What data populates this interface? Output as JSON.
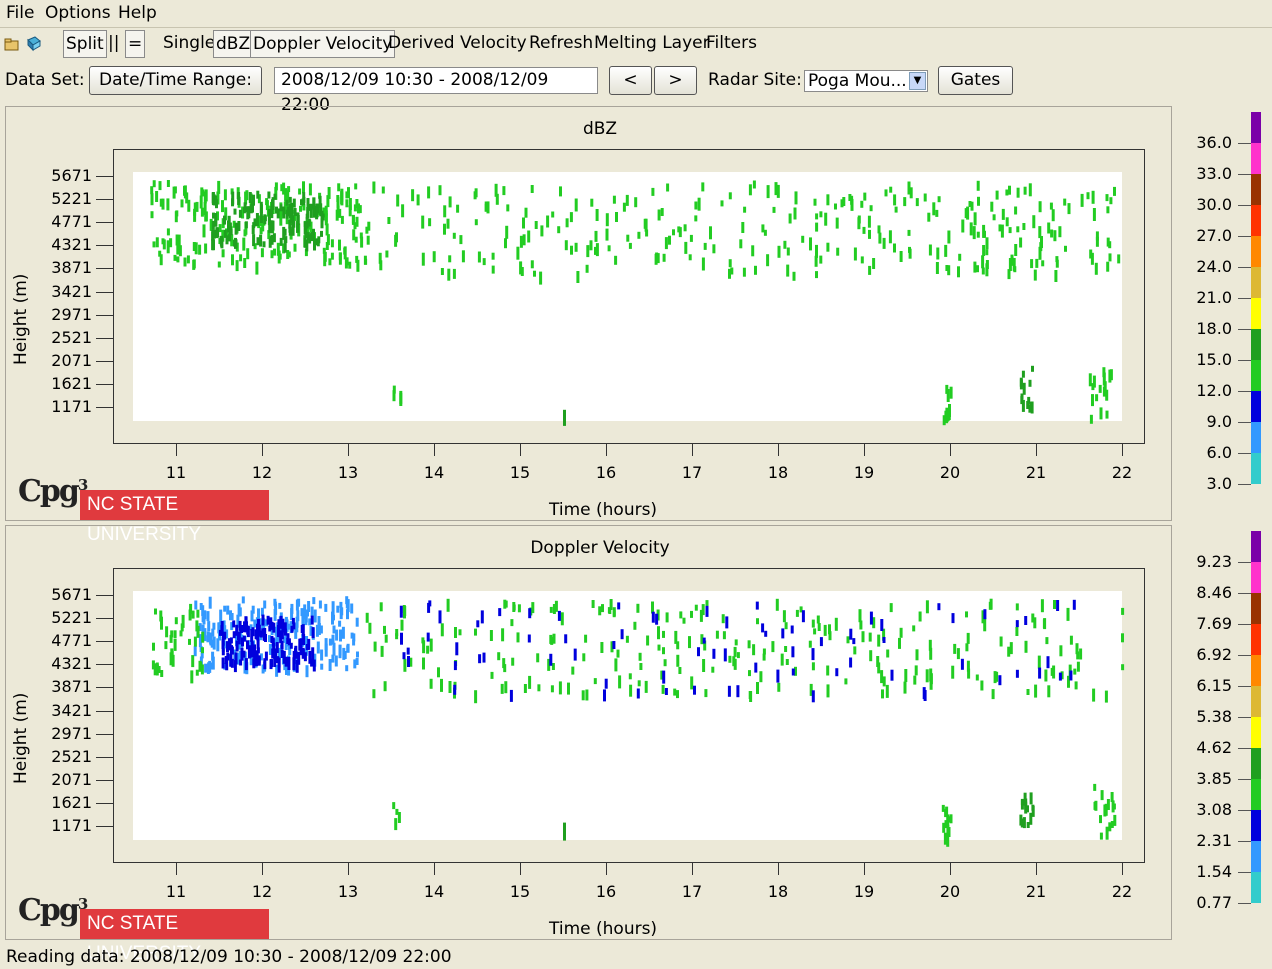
{
  "menu": [
    "File",
    "Options",
    "Help"
  ],
  "toolbar": {
    "split": "Split",
    "pipes": "||",
    "equals": "=",
    "single": "Single",
    "dbz": "dBZ",
    "doppler": "Doppler Velocity",
    "derived": "Derived Velocity",
    "refresh": "Refresh",
    "melting": "Melting Layer",
    "filters": "Filters"
  },
  "dataset": {
    "label": "Data Set:",
    "range_button": "Date/Time Range:",
    "range_value": "2008/12/09 10:30 - 2008/12/09 22:00",
    "prev": "<",
    "next": ">",
    "radar_label": "Radar Site:",
    "radar_value": "Poga Mou...",
    "gates": "Gates"
  },
  "logo": {
    "cpg": "Cpg",
    "sup": "3",
    "ncsu": "NC STATE UNIVERSITY"
  },
  "status": "Reading data: 2008/12/09 10:30 - 2008/12/09 22:00",
  "colors": [
    "#33cccc",
    "#3399ff",
    "#0000dd",
    "#22cc22",
    "#1f9f1f",
    "#ffff00",
    "#ddb833",
    "#ff8800",
    "#ff3300",
    "#993300",
    "#ff33cc",
    "#7a00a8"
  ],
  "chart_data": [
    {
      "type": "heatmap",
      "title": "dBZ",
      "xlabel": "Time (hours)",
      "ylabel": "Height (m)",
      "x_ticks": [
        "11",
        "12",
        "13",
        "14",
        "15",
        "16",
        "17",
        "18",
        "19",
        "20",
        "21",
        "22"
      ],
      "y_ticks": [
        "5671",
        "5221",
        "4771",
        "4321",
        "3871",
        "3421",
        "2971",
        "2521",
        "2071",
        "1621",
        "1171"
      ],
      "xlim": [
        10.5,
        22
      ],
      "ylim": [
        900,
        5750
      ],
      "colorbar": [
        "36.0",
        "33.0",
        "30.0",
        "27.0",
        "24.0",
        "21.0",
        "18.0",
        "15.0",
        "12.0",
        "9.0",
        "6.0",
        "3.0"
      ],
      "clusters": [
        {
          "x": [
            10.7,
            13.2
          ],
          "y": [
            4000,
            5600
          ],
          "n": 220,
          "c": 3
        },
        {
          "x": [
            11.4,
            12.7
          ],
          "y": [
            4400,
            5400
          ],
          "n": 140,
          "c": 4
        },
        {
          "x": [
            13.2,
            22.0
          ],
          "y": [
            3800,
            5600
          ],
          "n": 300,
          "c": 3
        },
        {
          "x": [
            19.9,
            20.0
          ],
          "y": [
            1000,
            1650
          ],
          "n": 12,
          "c": 3
        },
        {
          "x": [
            20.8,
            20.95
          ],
          "y": [
            1200,
            2000
          ],
          "n": 14,
          "c": 4
        },
        {
          "x": [
            21.6,
            21.9
          ],
          "y": [
            1000,
            2000
          ],
          "n": 16,
          "c": 3
        },
        {
          "x": [
            13.5,
            13.6
          ],
          "y": [
            1300,
            1700
          ],
          "n": 4,
          "c": 3
        },
        {
          "x": [
            15.5,
            15.5
          ],
          "y": [
            1000,
            1250
          ],
          "n": 3,
          "c": 4
        }
      ]
    },
    {
      "type": "heatmap",
      "title": "Doppler Velocity",
      "xlabel": "Time (hours)",
      "ylabel": "Height (m)",
      "x_ticks": [
        "11",
        "12",
        "13",
        "14",
        "15",
        "16",
        "17",
        "18",
        "19",
        "20",
        "21",
        "22"
      ],
      "y_ticks": [
        "5671",
        "5221",
        "4771",
        "4321",
        "3871",
        "3421",
        "2971",
        "2521",
        "2071",
        "1621",
        "1171"
      ],
      "xlim": [
        10.5,
        22
      ],
      "ylim": [
        900,
        5750
      ],
      "colorbar": [
        "9.23",
        "8.46",
        "7.69",
        "6.92",
        "6.15",
        "5.38",
        "4.62",
        "3.85",
        "3.08",
        "2.31",
        "1.54",
        "0.77"
      ],
      "clusters": [
        {
          "x": [
            11.2,
            13.1
          ],
          "y": [
            4300,
            5650
          ],
          "n": 220,
          "c": 1
        },
        {
          "x": [
            11.5,
            12.6
          ],
          "y": [
            4400,
            5300
          ],
          "n": 140,
          "c": 2
        },
        {
          "x": [
            10.7,
            11.3
          ],
          "y": [
            4200,
            5500
          ],
          "n": 40,
          "c": 3
        },
        {
          "x": [
            13.2,
            22.0
          ],
          "y": [
            3800,
            5600
          ],
          "n": 260,
          "c": 3
        },
        {
          "x": [
            13.2,
            21.5
          ],
          "y": [
            3800,
            5600
          ],
          "n": 80,
          "c": 2
        },
        {
          "x": [
            19.9,
            20.0
          ],
          "y": [
            1000,
            1650
          ],
          "n": 12,
          "c": 3
        },
        {
          "x": [
            20.8,
            20.95
          ],
          "y": [
            1200,
            2000
          ],
          "n": 14,
          "c": 4
        },
        {
          "x": [
            21.6,
            21.9
          ],
          "y": [
            1000,
            2000
          ],
          "n": 16,
          "c": 3
        },
        {
          "x": [
            13.5,
            13.6
          ],
          "y": [
            1300,
            1700
          ],
          "n": 4,
          "c": 3
        },
        {
          "x": [
            15.5,
            15.5
          ],
          "y": [
            1000,
            1250
          ],
          "n": 3,
          "c": 4
        }
      ]
    }
  ]
}
